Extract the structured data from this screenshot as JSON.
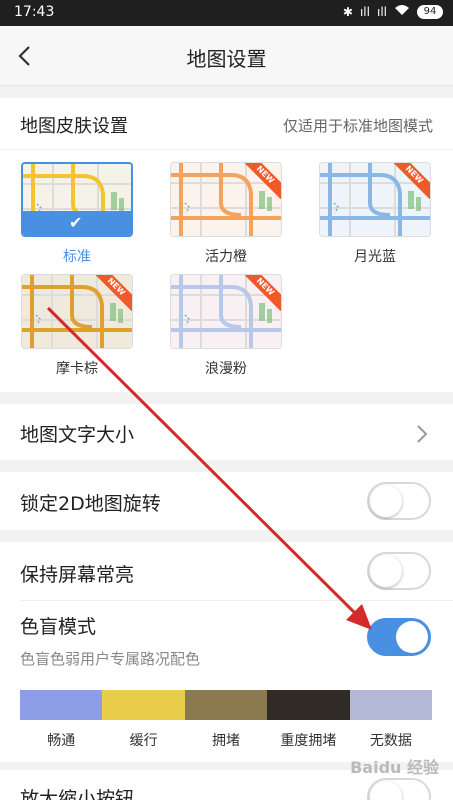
{
  "status_bar": {
    "time": "17:43",
    "signal1": "ıll",
    "signal2": "ıll",
    "wifi": "wifi-icon",
    "battery": "94"
  },
  "header": {
    "title": "地图设置"
  },
  "skin_section": {
    "title": "地图皮肤设置",
    "note": "仅适用于标准地图模式",
    "new_badge": "NEW",
    "skins": [
      {
        "label": "标准",
        "selected": true,
        "new": false,
        "road_color": "#f4c430",
        "bg": "#f5f3e8"
      },
      {
        "label": "活力橙",
        "selected": false,
        "new": true,
        "road_color": "#f5a35c",
        "bg": "#fbf3ec"
      },
      {
        "label": "月光蓝",
        "selected": false,
        "new": true,
        "road_color": "#8ab8e6",
        "bg": "#eef4fa"
      },
      {
        "label": "摩卡棕",
        "selected": false,
        "new": true,
        "road_color": "#e0a030",
        "bg": "#efeadb"
      },
      {
        "label": "浪漫粉",
        "selected": false,
        "new": true,
        "road_color": "#b8c8e8",
        "bg": "#f8f0f2"
      }
    ]
  },
  "rows": {
    "text_size": {
      "label": "地图文字大小"
    },
    "lock_2d": {
      "label": "锁定2D地图旋转",
      "on": false
    },
    "keep_screen": {
      "label": "保持屏幕常亮",
      "on": false
    },
    "color_blind": {
      "label": "色盲模式",
      "desc": "色盲色弱用户专属路况配色",
      "on": true
    },
    "zoom_buttons": {
      "label": "放大缩小按钮"
    }
  },
  "traffic_legend": [
    {
      "label": "畅通",
      "color": "#8e9ee6"
    },
    {
      "label": "缓行",
      "color": "#e8cc4a"
    },
    {
      "label": "拥堵",
      "color": "#8a7a4e"
    },
    {
      "label": "重度拥堵",
      "color": "#302b26"
    },
    {
      "label": "无数据",
      "color": "#b3b8d6"
    }
  ],
  "watermark": "Baidu 经验",
  "colors": {
    "accent": "#4a90e2",
    "annotation_arrow": "#d42a2a"
  }
}
